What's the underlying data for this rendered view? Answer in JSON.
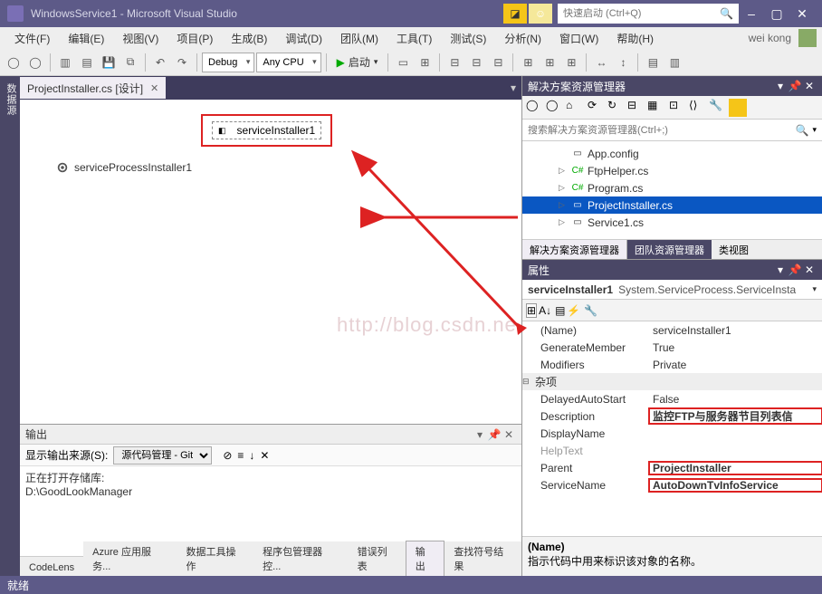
{
  "title": "WindowsService1 - Microsoft Visual Studio",
  "quickLaunch": "快速启动 (Ctrl+Q)",
  "menus": [
    "文件(F)",
    "编辑(E)",
    "视图(V)",
    "项目(P)",
    "生成(B)",
    "调试(D)",
    "团队(M)",
    "工具(T)",
    "测试(S)",
    "分析(N)",
    "窗口(W)",
    "帮助(H)"
  ],
  "user": "wei kong",
  "toolbar": {
    "config": "Debug",
    "platform": "Any CPU",
    "start": "启动"
  },
  "docTab": "ProjectInstaller.cs [设计]",
  "components": {
    "c1": "serviceInstaller1",
    "c2": "serviceProcessInstaller1"
  },
  "watermark": "http://blog.csdn.ne",
  "output": {
    "title": "输出",
    "sourceLabel": "显示输出来源(S):",
    "source": "源代码管理 - Git",
    "line1": "正在打开存储库:",
    "line2": "D:\\GoodLookManager"
  },
  "bottomTabs": [
    "CodeLens",
    "Azure 应用服务...",
    "数据工具操作",
    "程序包管理器控...",
    "错误列表",
    "输出",
    "查找符号结果"
  ],
  "solEx": {
    "title": "解决方案资源管理器",
    "searchPlaceholder": "搜索解决方案资源管理器(Ctrl+;)",
    "items": [
      {
        "label": "App.config",
        "icon": "cfg"
      },
      {
        "label": "FtpHelper.cs",
        "icon": "cs"
      },
      {
        "label": "Program.cs",
        "icon": "cs"
      },
      {
        "label": "ProjectInstaller.cs",
        "icon": "cs",
        "selected": true
      },
      {
        "label": "Service1.cs",
        "icon": "cs"
      }
    ],
    "tabs": [
      "解决方案资源管理器",
      "团队资源管理器",
      "类视图"
    ]
  },
  "props": {
    "title": "属性",
    "selName": "serviceInstaller1",
    "selType": "System.ServiceProcess.ServiceInsta",
    "rows": [
      {
        "name": "(Name)",
        "val": "serviceInstaller1",
        "indent": true
      },
      {
        "name": "GenerateMember",
        "val": "True",
        "indent": true
      },
      {
        "name": "Modifiers",
        "val": "Private",
        "indent": true
      },
      {
        "cat": "杂项"
      },
      {
        "name": "DelayedAutoStart",
        "val": "False",
        "indent": true
      },
      {
        "name": "Description",
        "val": "监控FTP与服务器节目列表信",
        "indent": true,
        "bold": true,
        "hl": true
      },
      {
        "name": "DisplayName",
        "val": "",
        "indent": true
      },
      {
        "name": "HelpText",
        "val": "",
        "indent": true,
        "dim": true
      },
      {
        "name": "Parent",
        "val": "ProjectInstaller",
        "indent": true,
        "bold": true,
        "hl": true
      },
      {
        "name": "ServiceName",
        "val": "AutoDownTvInfoService",
        "indent": true,
        "bold": true,
        "hl": true
      }
    ],
    "descName": "(Name)",
    "descText": "指示代码中用来标识该对象的名称。"
  },
  "status": "就绪"
}
